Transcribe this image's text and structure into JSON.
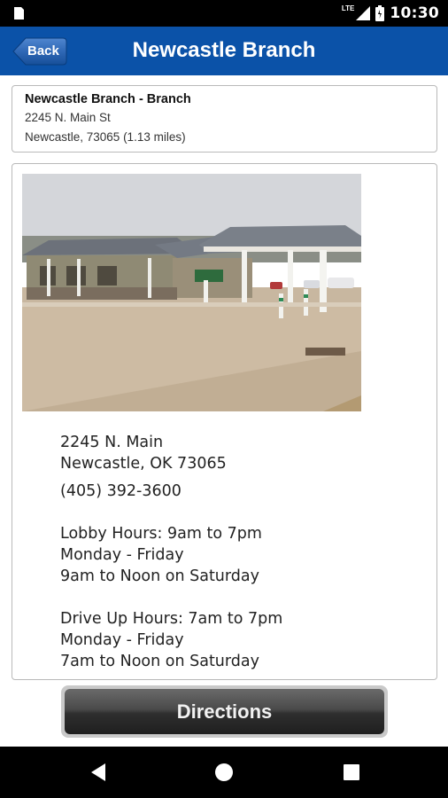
{
  "status_bar": {
    "time": "10:30",
    "network": "LTE",
    "icons": [
      "app-notification-icon",
      "signal-icon",
      "battery-icon"
    ]
  },
  "app_bar": {
    "back_label": "Back",
    "title": "Newcastle Branch",
    "color": "#0b52a8"
  },
  "branch_summary": {
    "name": "Newcastle Branch - Branch",
    "street": "2245 N. Main St",
    "city_line": "Newcastle, 73065 (1.13 miles)"
  },
  "branch_detail": {
    "photo": "branch-building-photo",
    "address_line1": "2245 N. Main",
    "address_line2": "Newcastle, OK 73065",
    "phone": "(405) 392-3600",
    "lobby_hours": {
      "line1": "Lobby Hours: 9am to 7pm",
      "line2": "Monday - Friday",
      "line3": "9am to Noon on Saturday"
    },
    "drive_up_hours": {
      "line1": "Drive Up Hours: 7am to 7pm",
      "line2": "Monday - Friday",
      "line3": "7am to Noon on Saturday"
    }
  },
  "directions_button": {
    "label": "Directions"
  },
  "nav_bar": {
    "icons": [
      "back-triangle-icon",
      "home-circle-icon",
      "recents-square-icon"
    ]
  }
}
